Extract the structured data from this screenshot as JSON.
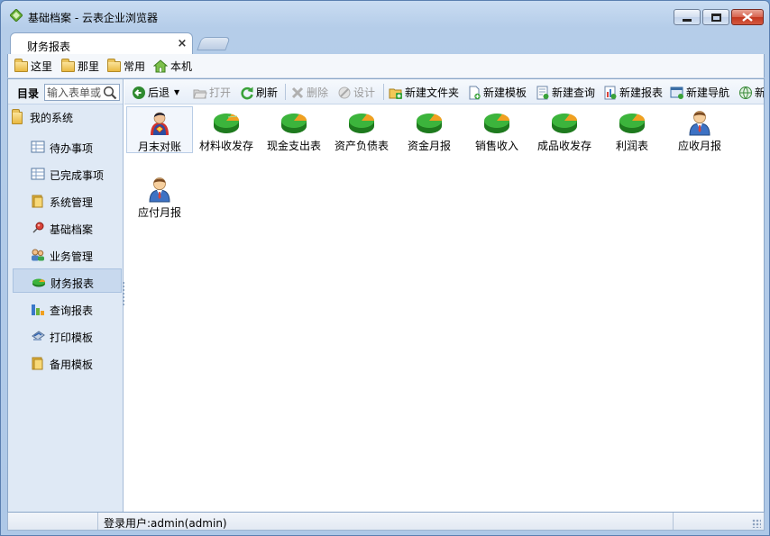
{
  "window": {
    "title": "基础档案 - 云表企业浏览器",
    "buttons": {
      "minimize": "minimize",
      "maximize": "maximize",
      "close": "close"
    }
  },
  "tab": {
    "label": "财务报表",
    "close_glyph": "×"
  },
  "bookmarks": [
    {
      "label": "这里",
      "icon": "folder-icon"
    },
    {
      "label": "那里",
      "icon": "folder-icon"
    },
    {
      "label": "常用",
      "icon": "folder-icon"
    },
    {
      "label": "本机",
      "icon": "home-icon"
    }
  ],
  "sidebar": {
    "heading": "目录",
    "search_placeholder": "输入表单或",
    "root": "我的系统",
    "items": [
      {
        "label": "待办事项",
        "icon": "table-icon"
      },
      {
        "label": "已完成事项",
        "icon": "table-icon"
      },
      {
        "label": "系统管理",
        "icon": "folder-icon"
      },
      {
        "label": "基础档案",
        "icon": "pushpin-icon"
      },
      {
        "label": "业务管理",
        "icon": "users-icon"
      },
      {
        "label": "财务报表",
        "icon": "pie-icon",
        "selected": true
      },
      {
        "label": "查询报表",
        "icon": "bar-chart-icon"
      },
      {
        "label": "打印模板",
        "icon": "printer-icon"
      },
      {
        "label": "备用模板",
        "icon": "folder-icon"
      }
    ]
  },
  "toolbar": {
    "back": "后退",
    "open": "打开",
    "refresh": "刷新",
    "delete": "删除",
    "design": "设计",
    "new_folder": "新建文件夹",
    "new_template": "新建模板",
    "new_query": "新建查询",
    "new_report": "新建报表",
    "new_nav": "新建导航",
    "new_more": "新"
  },
  "files": [
    {
      "label": "月末对账",
      "icon": "superman-icon"
    },
    {
      "label": "材料收发存",
      "icon": "pie-chart-icon"
    },
    {
      "label": "现金支出表",
      "icon": "pie-chart-icon"
    },
    {
      "label": "资产负债表",
      "icon": "pie-chart-icon"
    },
    {
      "label": "资金月报",
      "icon": "pie-chart-icon"
    },
    {
      "label": "销售收入",
      "icon": "pie-chart-icon"
    },
    {
      "label": "成品收发存",
      "icon": "pie-chart-icon"
    },
    {
      "label": "利润表",
      "icon": "pie-chart-icon"
    },
    {
      "label": "应收月报",
      "icon": "person-icon"
    },
    {
      "label": "应付月报",
      "icon": "person-icon"
    }
  ],
  "status": {
    "user": "登录用户:admin(admin)"
  },
  "colors": {
    "pie_green": "#2e9e2e",
    "pie_orange": "#f0a020",
    "accent": "#3a6ea5"
  }
}
